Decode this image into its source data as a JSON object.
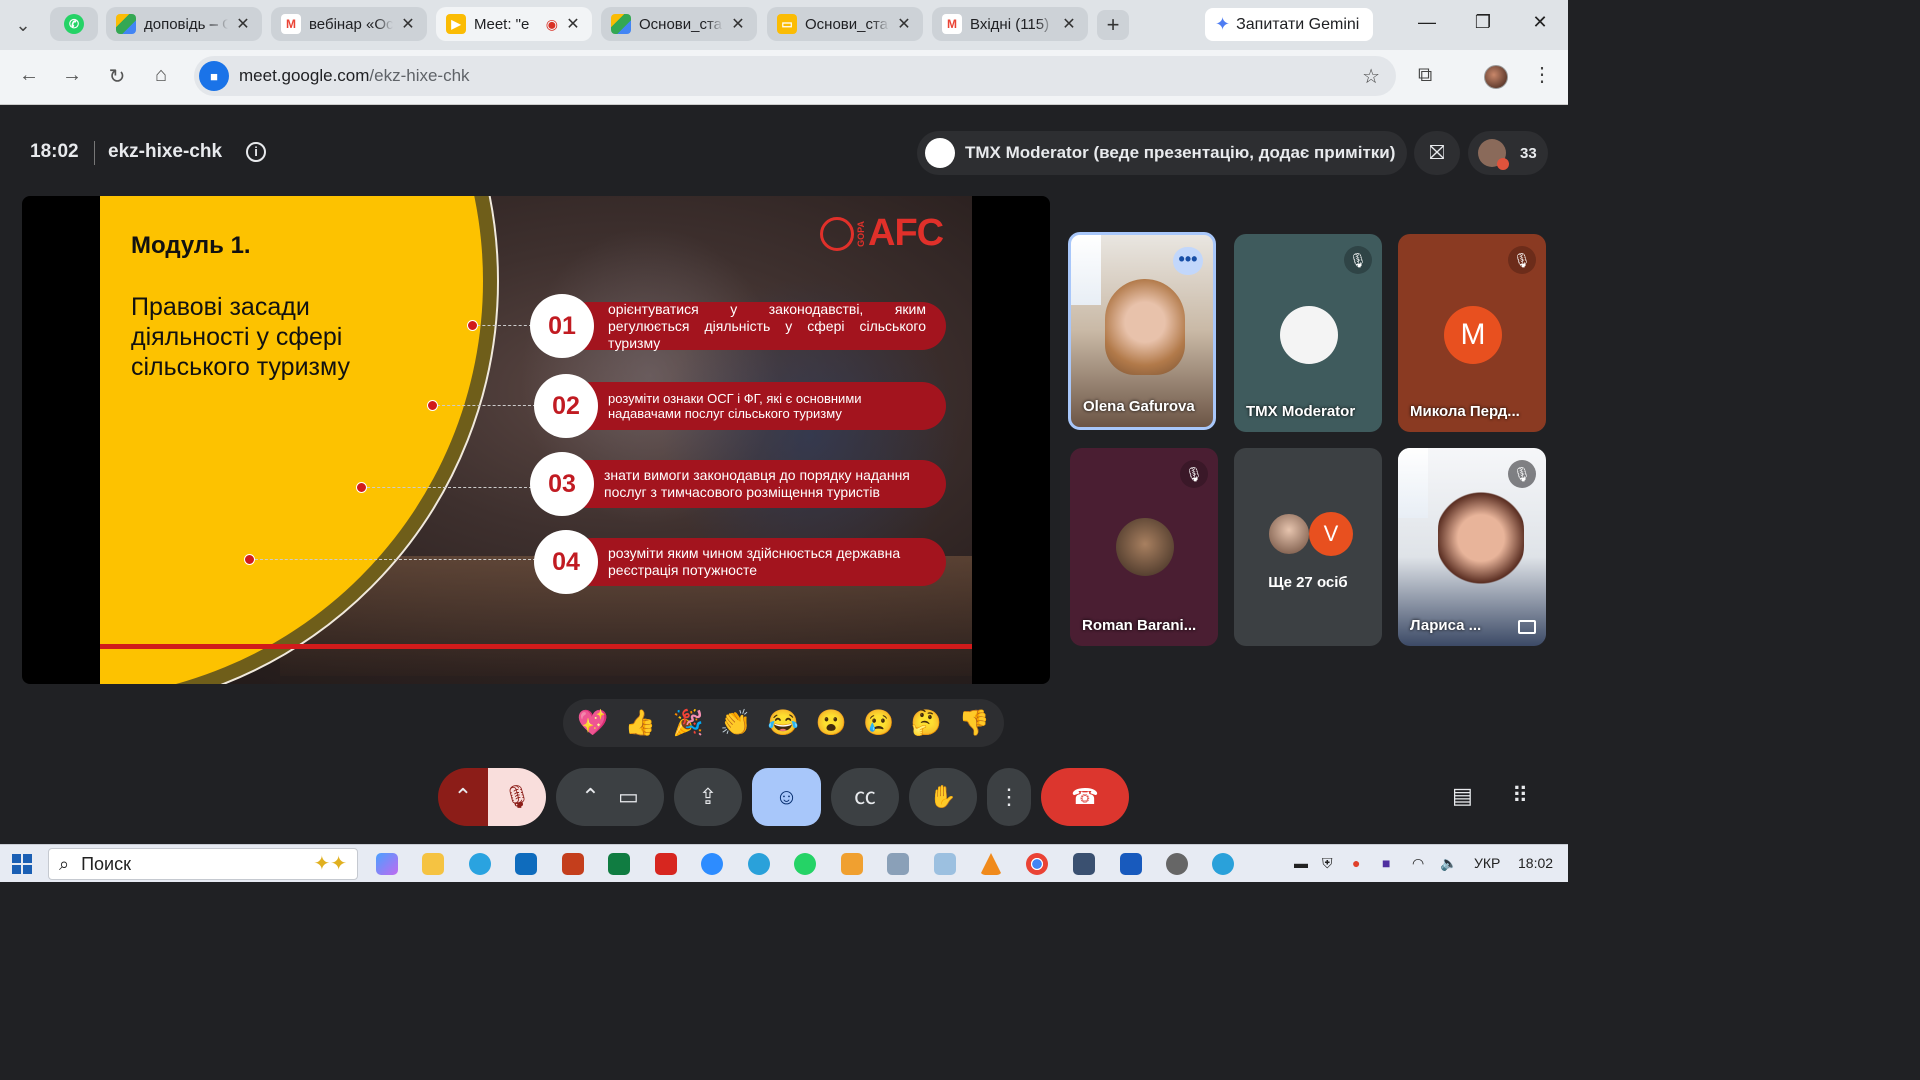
{
  "browser": {
    "tabs": [
      {
        "label": "доповідь – G",
        "favicon": "drive-icon",
        "color": "#34a853"
      },
      {
        "label": "вебінар «Ос",
        "favicon": "gmail-icon",
        "color": "#ea4335"
      },
      {
        "label": "Meet: \"e",
        "favicon": "meet-icon",
        "color": "#fbbc04"
      },
      {
        "label": "Основи_ста",
        "favicon": "drive-icon",
        "color": "#34a853"
      },
      {
        "label": "Основи_ста",
        "favicon": "slides-icon",
        "color": "#fbbc04"
      },
      {
        "label": "Вхідні (115)",
        "favicon": "gmail-icon",
        "color": "#ea4335"
      }
    ],
    "gemini_label": "Запитати Gemini",
    "url_host": "meet.google.com",
    "url_path": "/ekz-hixe-chk"
  },
  "meet": {
    "time": "18:02",
    "code": "ekz-hixe-chk",
    "presenter_label": "TMX Moderator (веде презентацію, додає примітки)",
    "participant_count": "33"
  },
  "slide": {
    "module": "Модуль 1.",
    "subtitle": "Правові засади діяльності у сфері сільського туризму",
    "logo_side": "GOPA",
    "logo": "AFC",
    "items": [
      {
        "num": "01",
        "text": "орієнтуватися у законодавстві, яким регулюється діяльність у сфері сільського туризму"
      },
      {
        "num": "02",
        "text": "розуміти ознаки ОСГ і ФГ, які є основними надавачами послуг сільського туризму"
      },
      {
        "num": "03",
        "text": "знати вимоги законодавця до порядку надання послуг з тимчасового розміщення туристів"
      },
      {
        "num": "04",
        "text": "розуміти яким чином здійснюється державна реєстрація потужносте"
      }
    ]
  },
  "participants": [
    {
      "name": "Olena Gafurova",
      "bg": "#c9c0b5"
    },
    {
      "name": "TMX Moderator",
      "bg": "#3f5b5d"
    },
    {
      "name": "Микола Перд...",
      "bg": "#8a3a22",
      "initial": "M"
    },
    {
      "name": "Roman Barani...",
      "bg": "#4a1e32"
    },
    {
      "more": "Ще 27 осіб",
      "initial": "V",
      "bg": "#3c4043"
    },
    {
      "name": "Лариса ...",
      "bg": "#cfd6de"
    }
  ],
  "reactions": [
    "💖",
    "👍",
    "🎉",
    "👏",
    "😂",
    "😮",
    "😢",
    "🤔",
    "👎"
  ],
  "taskbar": {
    "search_placeholder": "Поиск",
    "lang": "УКР",
    "time": "18:02"
  }
}
